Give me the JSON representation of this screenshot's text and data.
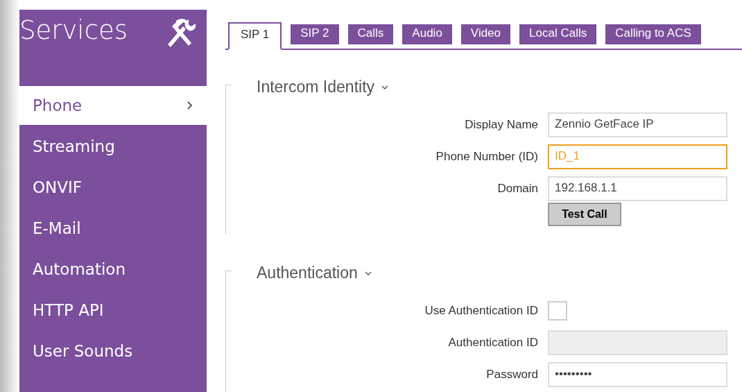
{
  "sidebar": {
    "title": "Services",
    "items": [
      {
        "label": "Phone",
        "selected": true
      },
      {
        "label": "Streaming",
        "selected": false
      },
      {
        "label": "ONVIF",
        "selected": false
      },
      {
        "label": "E-Mail",
        "selected": false
      },
      {
        "label": "Automation",
        "selected": false
      },
      {
        "label": "HTTP API",
        "selected": false
      },
      {
        "label": "User Sounds",
        "selected": false
      }
    ]
  },
  "tabs": [
    {
      "label": "SIP 1",
      "selected": true
    },
    {
      "label": "SIP 2",
      "selected": false
    },
    {
      "label": "Calls",
      "selected": false
    },
    {
      "label": "Audio",
      "selected": false
    },
    {
      "label": "Video",
      "selected": false
    },
    {
      "label": "Local Calls",
      "selected": false
    },
    {
      "label": "Calling to ACS",
      "selected": false
    }
  ],
  "sections": [
    {
      "title": "Intercom Identity",
      "expanded": true,
      "fields": [
        {
          "kind": "text",
          "label": "Display Name",
          "value": "Zennio GetFace IP",
          "focused": false
        },
        {
          "kind": "text",
          "label": "Phone Number (ID)",
          "value": "ID_1",
          "focused": true
        },
        {
          "kind": "text",
          "label": "Domain",
          "value": "192.168.1.1",
          "focused": false
        },
        {
          "kind": "button",
          "label": "Test Call"
        }
      ]
    },
    {
      "title": "Authentication",
      "expanded": true,
      "fields": [
        {
          "kind": "checkbox",
          "label": "Use Authentication ID",
          "checked": false
        },
        {
          "kind": "text",
          "label": "Authentication ID",
          "disabled": true,
          "focused": false
        },
        {
          "kind": "text",
          "label": "Password",
          "value": "•••••••••",
          "focused": false
        }
      ]
    }
  ]
}
